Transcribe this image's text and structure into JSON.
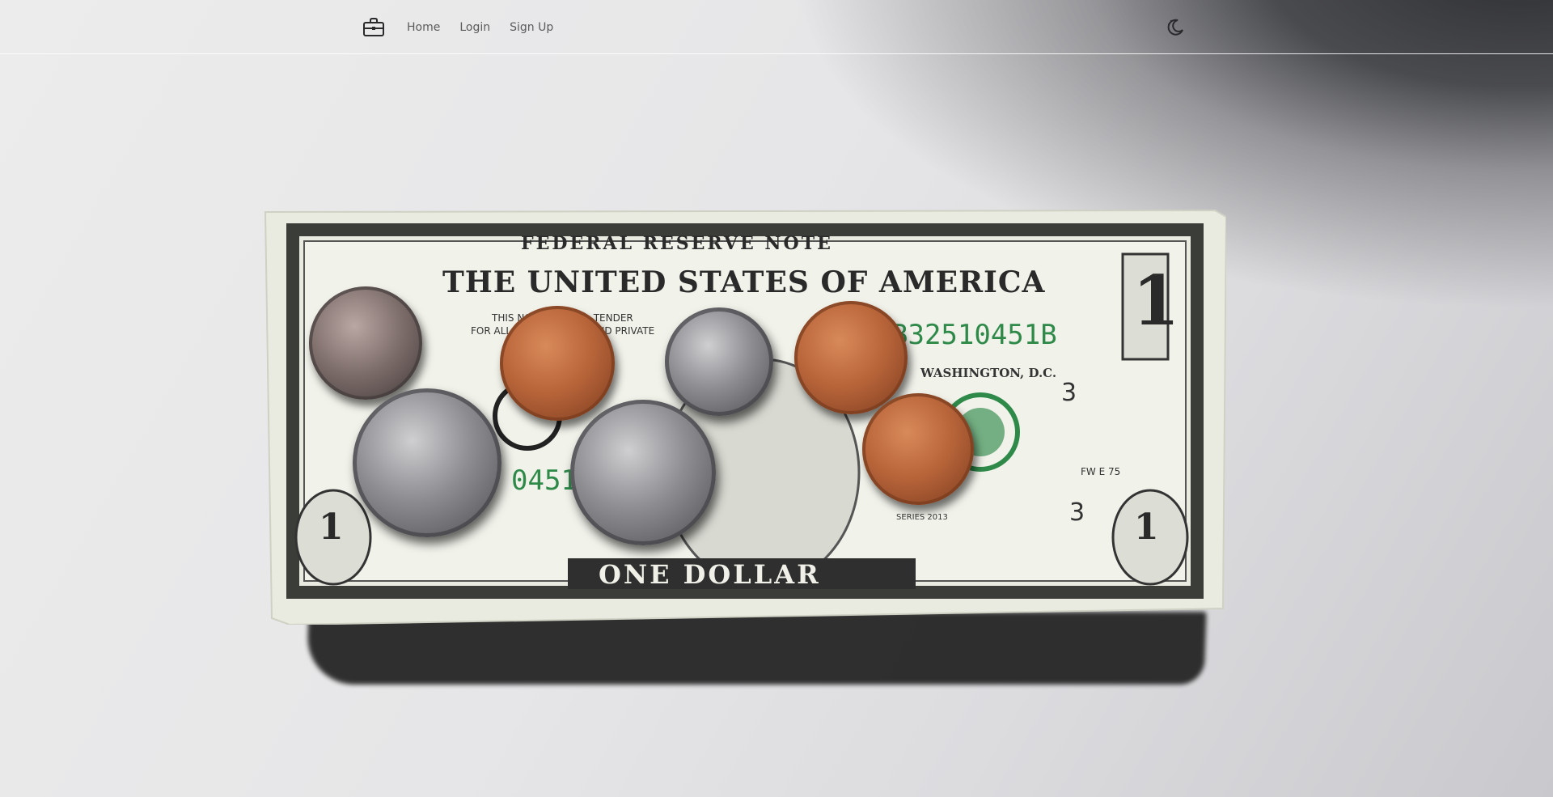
{
  "navbar": {
    "brand_icon": "briefcase-icon",
    "links": [
      {
        "label": "Home"
      },
      {
        "label": "Login"
      },
      {
        "label": "Sign Up"
      }
    ],
    "theme_toggle_icon": "moon-stars-icon"
  },
  "photo": {
    "bill": {
      "header": "FEDERAL RESERVE NOTE",
      "title": "THE UNITED STATES OF AMERICA",
      "denomination_text": "ONE DOLLAR",
      "serial_number": "B32510451B",
      "serial_partial": "0451",
      "city": "WASHINGTON, D.C.",
      "number": "1",
      "small_number": "3",
      "tender_line1": "THIS NOTE IS LEGAL TENDER",
      "tender_line2": "FOR ALL DEBTS, PUBLIC AND PRIVATE",
      "series": "SERIES 2013",
      "plate": "FW E 75"
    },
    "colors": {
      "bill_border": "#3a3d38",
      "seal_green": "#2f8a4a",
      "paper": "#e9ebe0"
    }
  }
}
